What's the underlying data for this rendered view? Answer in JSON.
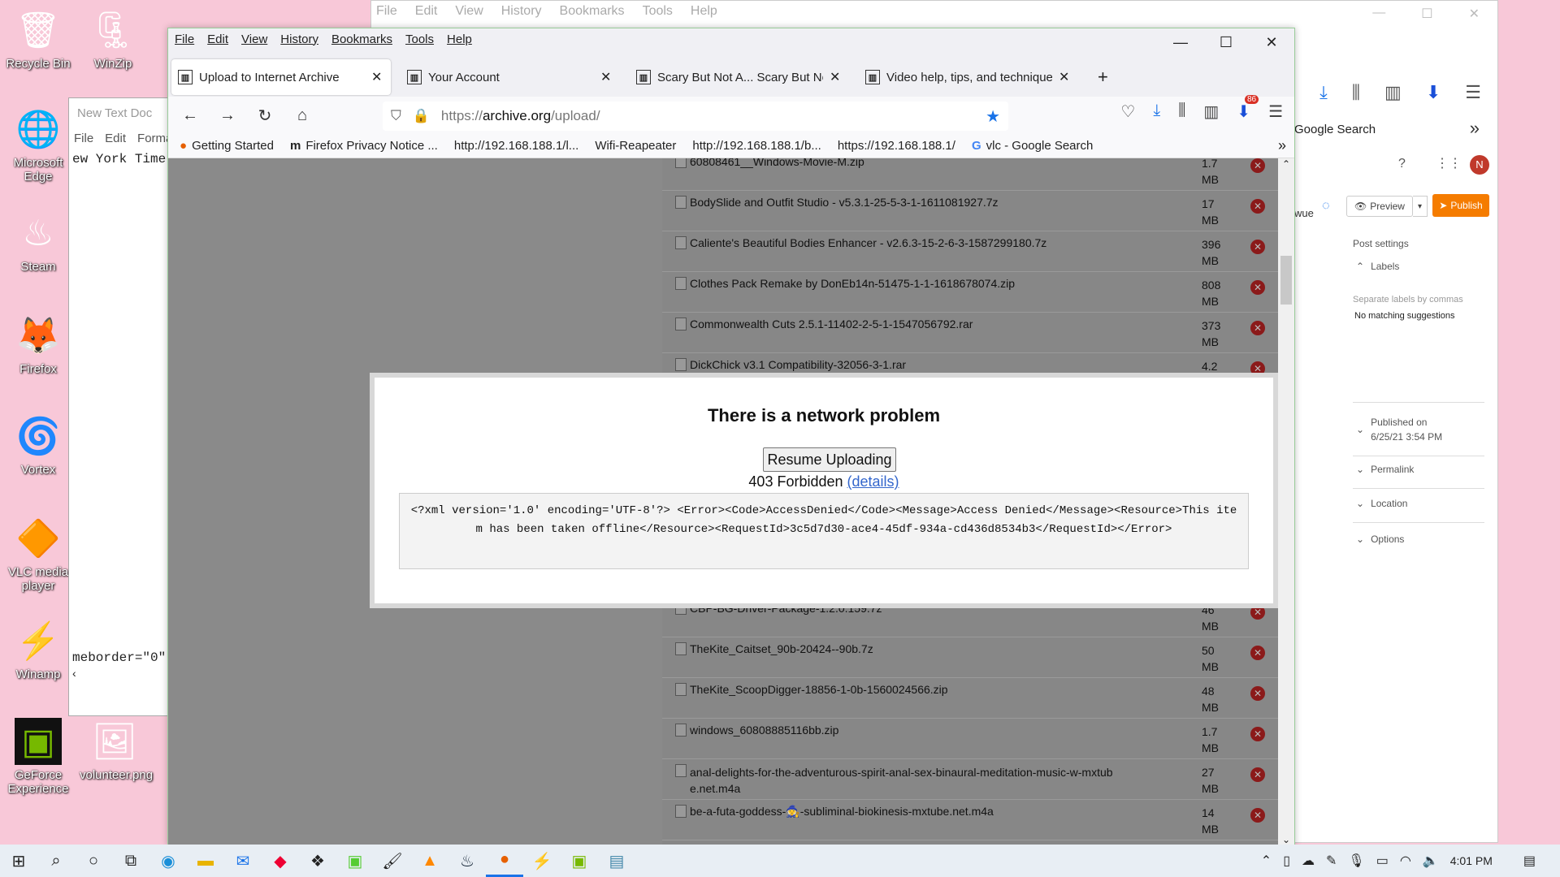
{
  "desktop": {
    "icons": [
      {
        "label": "Recycle Bin",
        "glyph": "🗑"
      },
      {
        "label": "WinZip",
        "glyph": "🗜"
      },
      {
        "label": "Microsoft Edge",
        "glyph": "🌐"
      },
      {
        "label": "Steam",
        "glyph": "♨"
      },
      {
        "label": "Firefox",
        "glyph": "🦊"
      },
      {
        "label": "Vortex",
        "glyph": "🌀"
      },
      {
        "label": "VLC media player",
        "glyph": "🔶"
      },
      {
        "label": "Winamp",
        "glyph": "⚡"
      },
      {
        "label": "GeForce Experience",
        "glyph": "▣"
      },
      {
        "label": "volunteer.png",
        "glyph": "🖼"
      }
    ]
  },
  "notepad": {
    "title": "New Text Doc",
    "menu": [
      "File",
      "Edit",
      "Forma"
    ],
    "line1": "ew York Time",
    "line2": "meborder=\"0\""
  },
  "background_window": {
    "menu": [
      "File",
      "Edit",
      "View",
      "History",
      "Bookmarks",
      "Tools",
      "Help"
    ],
    "bookmark_partial": "Google Search",
    "partial_text": "wue",
    "preview_label": "Preview",
    "publish_label": "Publish",
    "post_settings": "Post settings",
    "labels_heading": "Labels",
    "labels_hint": "Separate labels by commas",
    "no_match": "No matching suggestions",
    "published_on_label": "Published on",
    "published_on_value": "6/25/21 3:54 PM",
    "permalink": "Permalink",
    "location": "Location",
    "options": "Options",
    "avatar_letter": "N"
  },
  "firefox": {
    "menu": [
      "File",
      "Edit",
      "View",
      "History",
      "Bookmarks",
      "Tools",
      "Help"
    ],
    "tabs": [
      {
        "label": "Upload to Internet Archive",
        "active": true
      },
      {
        "label": "Your Account",
        "active": false
      },
      {
        "label": "Scary But Not A... Scary But Not",
        "active": false
      },
      {
        "label": "Video help, tips, and techniques",
        "active": false
      }
    ],
    "url_prefix": "https://",
    "url_host": "archive.org",
    "url_path": "/upload/",
    "badge_count": "86",
    "bookmarks": [
      "Getting Started",
      "Firefox Privacy Notice ...",
      "http://192.168.188.1/l...",
      "Wifi-Reapeater",
      "http://192.168.188.1/b...",
      "https://192.168.188.1/",
      "vlc - Google Search"
    ]
  },
  "files": [
    {
      "name": "60808461__Windows-Movie-M.zip",
      "size": "1.7 MB"
    },
    {
      "name": "BodySlide and Outfit Studio - v5.3.1-25-5-3-1-1611081927.7z",
      "size": "17 MB"
    },
    {
      "name": "Caliente's Beautiful Bodies Enhancer - v2.6.3-15-2-6-3-1587299180.7z",
      "size": "396 MB"
    },
    {
      "name": "Clothes Pack Remake by DonEb14n-51475-1-1-1618678074.zip",
      "size": "808 MB"
    },
    {
      "name": "Commonwealth Cuts 2.5.1-11402-2-5-1-1547056792.rar",
      "size": "373 MB"
    },
    {
      "name": "DickChick v3.1 Compatibility-32056-3-1.rar",
      "size": "4.2 MB"
    }
  ],
  "files_below": [
    {
      "name": "CBP-BG-Driver-Package-1.2.0.159.7z",
      "size": "46 MB"
    },
    {
      "name": "TheKite_Caitset_90b-20424--90b.7z",
      "size": "50 MB"
    },
    {
      "name": "TheKite_ScoopDigger-18856-1-0b-1560024566.zip",
      "size": "48 MB"
    },
    {
      "name": "windows_60808885116bb.zip",
      "size": "1.7 MB"
    },
    {
      "name": "anal-delights-for-the-adventurous-spirit-anal-sex-binaural-meditation-music-w-mxtube.net.m4a",
      "size": "27 MB"
    },
    {
      "name": "be-a-futa-goddess-🧙-subliminal-biokinesis-mxtube.net.m4a",
      "size": "14 MB"
    }
  ],
  "modal": {
    "title": "There is a network problem",
    "resume_label": "Resume Uploading",
    "status": "403 Forbidden",
    "details_link": "(details)",
    "error_xml": "<?xml version='1.0' encoding='UTF-8'?> <Error><Code>AccessDenied</Code><Message>Access Denied</Message><Resource>This item has been taken offline</Resource><RequestId>3c5d7d30-ace4-45df-934a-cd436d8534b3</RequestId></Error>"
  },
  "taskbar": {
    "time": "4:01 PM"
  }
}
